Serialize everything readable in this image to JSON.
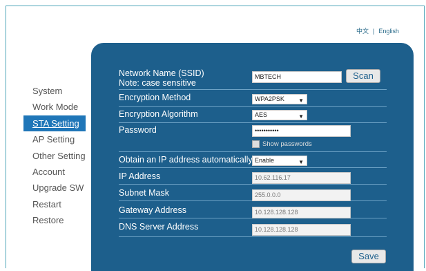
{
  "language": {
    "chinese": "中文",
    "separator": "|",
    "english": "English"
  },
  "sidebar": {
    "items": [
      {
        "label": "System"
      },
      {
        "label": "Work Mode"
      },
      {
        "label": "STA Setting",
        "active": true
      },
      {
        "label": "AP Setting"
      },
      {
        "label": "Other Setting"
      },
      {
        "label": "Account"
      },
      {
        "label": "Upgrade SW"
      },
      {
        "label": "Restart"
      },
      {
        "label": "Restore"
      }
    ]
  },
  "form": {
    "ssid_label": "Network Name (SSID)",
    "ssid_note": "Note: case sensitive",
    "ssid_value": "MBTECH",
    "scan_label": "Scan",
    "encryption_method_label": "Encryption Method",
    "encryption_method_value": "WPA2PSK",
    "encryption_algorithm_label": "Encryption Algorithm",
    "encryption_algorithm_value": "AES",
    "password_label": "Password",
    "password_value": "•••••••••••",
    "show_passwords_label": "Show passwords",
    "dhcp_label": "Obtain an IP address automatically",
    "dhcp_value": "Enable",
    "ip_label": "IP Address",
    "ip_value": "10.62.116.17",
    "subnet_label": "Subnet Mask",
    "subnet_value": "255.0.0.0",
    "gateway_label": "Gateway Address",
    "gateway_value": "10.128.128.128",
    "dns_label": "DNS Server Address",
    "dns_value": "10.128.128.128",
    "save_label": "Save"
  },
  "colors": {
    "panel": "#1d5f8c",
    "active_nav": "#1f76b8",
    "frame_border": "#4aa3b8"
  },
  "icons": {
    "caret": "caret-down-icon",
    "checkbox": "checkbox-icon"
  }
}
